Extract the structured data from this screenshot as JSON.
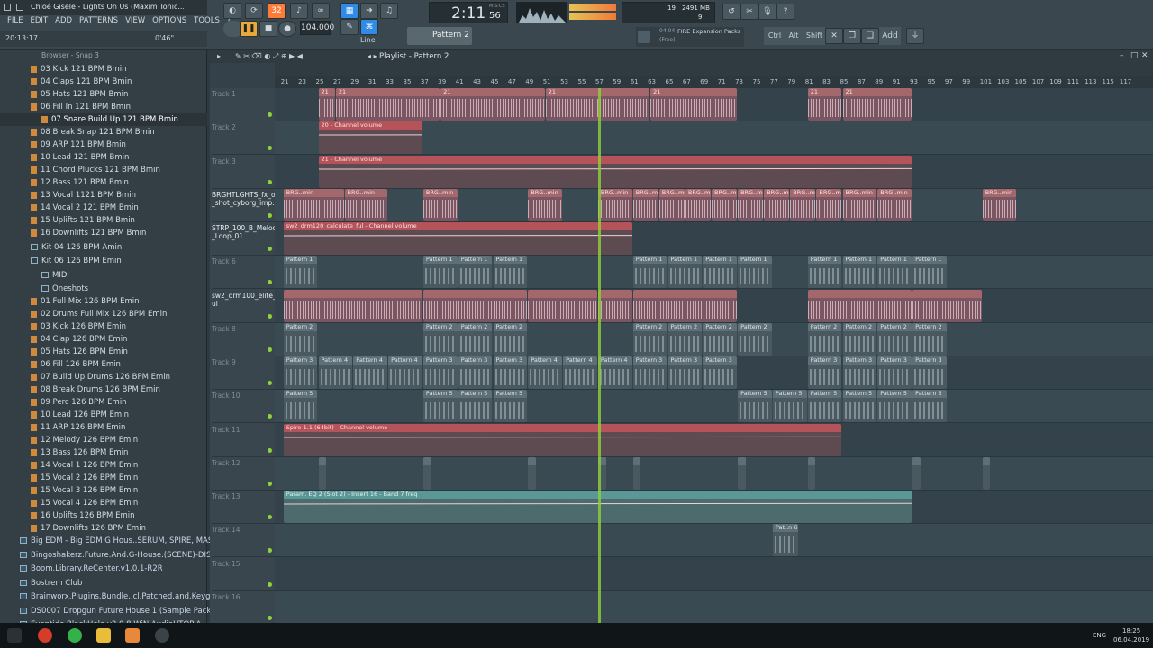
{
  "window": {
    "title": "Chloé Gisele - Lights On Us (Maxim Tonic...",
    "menu": [
      "FILE",
      "EDIT",
      "ADD",
      "PATTERNS",
      "VIEW",
      "OPTIONS",
      "TOOLS",
      "?"
    ],
    "hint_time": "20:13:17",
    "hint_pos": "0'46\""
  },
  "transport": {
    "time": "2:11",
    "time_sub": "56",
    "time_label": "M:S:CS",
    "tempo": "104.000",
    "pattern": "Pattern 2",
    "snap": "Line",
    "cpu": "19",
    "mem": "2491 MB",
    "voices": "9"
  },
  "news": {
    "date": "04.04",
    "text": "FIRE Expansion Packs",
    "sub": "(Free)"
  },
  "keys": [
    "Ctrl",
    "Alt",
    "Shift",
    "Add"
  ],
  "browser": {
    "header": "Browser - Snap 3",
    "items": [
      {
        "label": "03 Kick 121 BPM Bmin",
        "type": "file",
        "indent": 1
      },
      {
        "label": "04 Claps 121 BPM Bmin",
        "type": "file",
        "indent": 1
      },
      {
        "label": "05 Hats 121 BPM Bmin",
        "type": "file",
        "indent": 1
      },
      {
        "label": "06 Fill In 121 BPM Bmin",
        "type": "file",
        "indent": 1
      },
      {
        "label": "07 Snare Build Up 121 BPM Bmin",
        "type": "file",
        "indent": 2,
        "selected": true
      },
      {
        "label": "08 Break Snap 121 BPM Bmin",
        "type": "file",
        "indent": 1
      },
      {
        "label": "09 ARP 121 BPM Bmin",
        "type": "file",
        "indent": 1
      },
      {
        "label": "10 Lead 121 BPM Bmin",
        "type": "file",
        "indent": 1
      },
      {
        "label": "11 Chord Plucks 121 BPM Bmin",
        "type": "file",
        "indent": 1
      },
      {
        "label": "12 Bass 121 BPM Bmin",
        "type": "file",
        "indent": 1
      },
      {
        "label": "13 Vocal 1121 BPM Bmin",
        "type": "file",
        "indent": 1
      },
      {
        "label": "14 Vocal 2 121 BPM Bmin",
        "type": "file",
        "indent": 1
      },
      {
        "label": "15 Uplifts 121 BPM Bmin",
        "type": "file",
        "indent": 1
      },
      {
        "label": "16 Downlifts 121 BPM Bmin",
        "type": "file",
        "indent": 1
      },
      {
        "label": "Kit 04 126 BPM Amin",
        "type": "folder",
        "indent": 1
      },
      {
        "label": "Kit 06 126 BPM Emin",
        "type": "folder",
        "indent": 1,
        "open": true
      },
      {
        "label": "MIDI",
        "type": "folder",
        "indent": 2
      },
      {
        "label": "Oneshots",
        "type": "folder",
        "indent": 2
      },
      {
        "label": "01 Full Mix 126 BPM Emin",
        "type": "file",
        "indent": 1
      },
      {
        "label": "02 Drums Full Mix 126 BPM Emin",
        "type": "file",
        "indent": 1
      },
      {
        "label": "03 Kick 126 BPM Emin",
        "type": "file",
        "indent": 1
      },
      {
        "label": "04 Clap 126 BPM Emin",
        "type": "file",
        "indent": 1
      },
      {
        "label": "05 Hats 126 BPM Emin",
        "type": "file",
        "indent": 1
      },
      {
        "label": "06 Fill 126 BPM Emin",
        "type": "file",
        "indent": 1
      },
      {
        "label": "07 Build Up Drums 126 BPM Emin",
        "type": "file",
        "indent": 1
      },
      {
        "label": "08 Break Drums 126 BPM Emin",
        "type": "file",
        "indent": 1
      },
      {
        "label": "09 Perc 126 BPM Emin",
        "type": "file",
        "indent": 1
      },
      {
        "label": "10 Lead 126 BPM Emin",
        "type": "file",
        "indent": 1
      },
      {
        "label": "11 ARP 126 BPM Emin",
        "type": "file",
        "indent": 1
      },
      {
        "label": "12 Melody 126 BPM Emin",
        "type": "file",
        "indent": 1
      },
      {
        "label": "13 Bass 126 BPM Emin",
        "type": "file",
        "indent": 1
      },
      {
        "label": "14 Vocal 1 126 BPM Emin",
        "type": "file",
        "indent": 1
      },
      {
        "label": "15 Vocal 2 126 BPM Emin",
        "type": "file",
        "indent": 1
      },
      {
        "label": "15 Vocal 3 126 BPM Emin",
        "type": "file",
        "indent": 1
      },
      {
        "label": "15 Vocal 4 126 BPM Emin",
        "type": "file",
        "indent": 1
      },
      {
        "label": "16 Uplifts 126 BPM Emin",
        "type": "file",
        "indent": 1
      },
      {
        "label": "17 Downlifts 126 BPM Emin",
        "type": "file",
        "indent": 1
      }
    ],
    "packs": [
      "Big EDM - Big EDM G Hous..SERUM, SPIRE, MASSIVE)",
      "Bingoshakerz.Future.And.G-House.(SCENE)-DISCOVER",
      "Boom.Library.ReCenter.v1.0.1-R2R",
      "Bostrem Club",
      "Brainworx.Plugins.Bundle..cl.Patched.and.Keygen-R2R",
      "DS0007 Dropgun Future House 1 (Sample Pack)",
      "Eventide.BlackHole.v2.0.8.WiN.AudioUTOPiA"
    ]
  },
  "playlist": {
    "title": "Playlist - Pattern 2",
    "ruler": [
      "21",
      "23",
      "25",
      "27",
      "29",
      "31",
      "33",
      "35",
      "37",
      "39",
      "41",
      "43",
      "45",
      "47",
      "49",
      "51",
      "53",
      "55",
      "57",
      "59",
      "61",
      "63",
      "65",
      "67",
      "69",
      "71",
      "73",
      "75",
      "77",
      "79",
      "81",
      "83",
      "85",
      "87",
      "89",
      "91",
      "93",
      "95",
      "97",
      "99",
      "101",
      "103",
      "105",
      "107",
      "109",
      "111",
      "113",
      "115",
      "117"
    ],
    "tracks": [
      {
        "name": "Track 1",
        "highlight": false
      },
      {
        "name": "Track 2",
        "highlight": false
      },
      {
        "name": "Track 3",
        "highlight": false
      },
      {
        "name": "BRGHTLGHTS_fx_one _shot_cyborg_imp..",
        "highlight": true
      },
      {
        "name": "STRP_100_B_Melody _Loop_01",
        "highlight": true
      },
      {
        "name": "Track 6",
        "highlight": false
      },
      {
        "name": "sw2_drm100_elite_f ul",
        "highlight": true
      },
      {
        "name": "Track 8",
        "highlight": false
      },
      {
        "name": "Track 9",
        "highlight": false
      },
      {
        "name": "Track 10",
        "highlight": false
      },
      {
        "name": "Track 11",
        "highlight": false
      },
      {
        "name": "Track 12",
        "highlight": false
      },
      {
        "name": "Track 13",
        "highlight": false
      },
      {
        "name": "Track 14",
        "highlight": false
      },
      {
        "name": "Track 15",
        "highlight": false
      },
      {
        "name": "Track 16",
        "highlight": false
      }
    ],
    "clips": [
      {
        "track": 0,
        "start": 25,
        "end": 27,
        "label": "21",
        "kind": "audio"
      },
      {
        "track": 0,
        "start": 27,
        "end": 39,
        "label": "21",
        "kind": "audio"
      },
      {
        "track": 0,
        "start": 39,
        "end": 51,
        "label": "21",
        "kind": "audio"
      },
      {
        "track": 0,
        "start": 51,
        "end": 63,
        "label": "21",
        "kind": "audio"
      },
      {
        "track": 0,
        "start": 63,
        "end": 73,
        "label": "21",
        "kind": "audio"
      },
      {
        "track": 0,
        "start": 81,
        "end": 85,
        "label": "21",
        "kind": "audio"
      },
      {
        "track": 0,
        "start": 85,
        "end": 93,
        "label": "21",
        "kind": "audio"
      },
      {
        "track": 1,
        "start": 25,
        "end": 37,
        "label": "20 - Channel volume",
        "kind": "auto"
      },
      {
        "track": 2,
        "start": 25,
        "end": 93,
        "label": "21 - Channel volume",
        "kind": "auto"
      },
      {
        "track": 3,
        "start": 21,
        "end": 28,
        "label": "BRG..min",
        "kind": "audio"
      },
      {
        "track": 3,
        "start": 28,
        "end": 33,
        "label": "BRG..min",
        "kind": "audio"
      },
      {
        "track": 3,
        "start": 37,
        "end": 41,
        "label": "BRG..min",
        "kind": "audio"
      },
      {
        "track": 3,
        "start": 49,
        "end": 53,
        "label": "BRG..min",
        "kind": "audio"
      },
      {
        "track": 3,
        "start": 57,
        "end": 61,
        "label": "BRG..min",
        "kind": "audio"
      },
      {
        "track": 3,
        "start": 61,
        "end": 64,
        "label": "BRG..min",
        "kind": "audio"
      },
      {
        "track": 3,
        "start": 64,
        "end": 67,
        "label": "BRG..min",
        "kind": "audio"
      },
      {
        "track": 3,
        "start": 67,
        "end": 70,
        "label": "BRG..min",
        "kind": "audio"
      },
      {
        "track": 3,
        "start": 70,
        "end": 73,
        "label": "BRG..min",
        "kind": "audio"
      },
      {
        "track": 3,
        "start": 73,
        "end": 76,
        "label": "BRG..min",
        "kind": "audio"
      },
      {
        "track": 3,
        "start": 76,
        "end": 79,
        "label": "BRG..min",
        "kind": "audio"
      },
      {
        "track": 3,
        "start": 79,
        "end": 82,
        "label": "BRG..min",
        "kind": "audio"
      },
      {
        "track": 3,
        "start": 82,
        "end": 85,
        "label": "BRG..min",
        "kind": "audio"
      },
      {
        "track": 3,
        "start": 85,
        "end": 89,
        "label": "BRG..min",
        "kind": "audio"
      },
      {
        "track": 3,
        "start": 89,
        "end": 93,
        "label": "BRG..min",
        "kind": "audio"
      },
      {
        "track": 3,
        "start": 101,
        "end": 105,
        "label": "BRG..min",
        "kind": "audio"
      },
      {
        "track": 4,
        "start": 21,
        "end": 61,
        "label": "sw2_drm120_calculate_ful - Channel volume",
        "kind": "auto"
      },
      {
        "track": 5,
        "start": 21,
        "end": 25,
        "label": "Pattern 1",
        "kind": "pat"
      },
      {
        "track": 5,
        "start": 37,
        "end": 41,
        "label": "Pattern 1",
        "kind": "pat"
      },
      {
        "track": 5,
        "start": 41,
        "end": 45,
        "label": "Pattern 1",
        "kind": "pat"
      },
      {
        "track": 5,
        "start": 45,
        "end": 49,
        "label": "Pattern 1",
        "kind": "pat"
      },
      {
        "track": 5,
        "start": 61,
        "end": 65,
        "label": "Pattern 1",
        "kind": "pat"
      },
      {
        "track": 5,
        "start": 65,
        "end": 69,
        "label": "Pattern 1",
        "kind": "pat"
      },
      {
        "track": 5,
        "start": 69,
        "end": 73,
        "label": "Pattern 1",
        "kind": "pat"
      },
      {
        "track": 5,
        "start": 73,
        "end": 77,
        "label": "Pattern 1",
        "kind": "pat"
      },
      {
        "track": 5,
        "start": 81,
        "end": 85,
        "label": "Pattern 1",
        "kind": "pat"
      },
      {
        "track": 5,
        "start": 85,
        "end": 89,
        "label": "Pattern 1",
        "kind": "pat"
      },
      {
        "track": 5,
        "start": 89,
        "end": 93,
        "label": "Pattern 1",
        "kind": "pat"
      },
      {
        "track": 5,
        "start": 93,
        "end": 97,
        "label": "Pattern 1",
        "kind": "pat"
      },
      {
        "track": 6,
        "start": 21,
        "end": 37,
        "label": "",
        "kind": "audio"
      },
      {
        "track": 6,
        "start": 37,
        "end": 49,
        "label": "",
        "kind": "audio"
      },
      {
        "track": 6,
        "start": 49,
        "end": 57,
        "label": "",
        "kind": "audio"
      },
      {
        "track": 6,
        "start": 57,
        "end": 61,
        "label": "",
        "kind": "audio"
      },
      {
        "track": 6,
        "start": 61,
        "end": 73,
        "label": "",
        "kind": "audio"
      },
      {
        "track": 6,
        "start": 81,
        "end": 93,
        "label": "",
        "kind": "audio"
      },
      {
        "track": 6,
        "start": 93,
        "end": 101,
        "label": "",
        "kind": "audio"
      },
      {
        "track": 7,
        "start": 21,
        "end": 25,
        "label": "Pattern 2",
        "kind": "pat"
      },
      {
        "track": 7,
        "start": 37,
        "end": 41,
        "label": "Pattern 2",
        "kind": "pat"
      },
      {
        "track": 7,
        "start": 41,
        "end": 45,
        "label": "Pattern 2",
        "kind": "pat"
      },
      {
        "track": 7,
        "start": 45,
        "end": 49,
        "label": "Pattern 2",
        "kind": "pat"
      },
      {
        "track": 7,
        "start": 61,
        "end": 65,
        "label": "Pattern 2",
        "kind": "pat"
      },
      {
        "track": 7,
        "start": 65,
        "end": 69,
        "label": "Pattern 2",
        "kind": "pat"
      },
      {
        "track": 7,
        "start": 69,
        "end": 73,
        "label": "Pattern 2",
        "kind": "pat"
      },
      {
        "track": 7,
        "start": 73,
        "end": 77,
        "label": "Pattern 2",
        "kind": "pat"
      },
      {
        "track": 7,
        "start": 81,
        "end": 85,
        "label": "Pattern 2",
        "kind": "pat"
      },
      {
        "track": 7,
        "start": 85,
        "end": 89,
        "label": "Pattern 2",
        "kind": "pat"
      },
      {
        "track": 7,
        "start": 89,
        "end": 93,
        "label": "Pattern 2",
        "kind": "pat"
      },
      {
        "track": 7,
        "start": 93,
        "end": 97,
        "label": "Pattern 2",
        "kind": "pat"
      },
      {
        "track": 8,
        "start": 21,
        "end": 25,
        "label": "Pattern 3",
        "kind": "pat"
      },
      {
        "track": 8,
        "start": 25,
        "end": 29,
        "label": "Pattern 4",
        "kind": "pat"
      },
      {
        "track": 8,
        "start": 29,
        "end": 33,
        "label": "Pattern 4",
        "kind": "pat"
      },
      {
        "track": 8,
        "start": 33,
        "end": 37,
        "label": "Pattern 4",
        "kind": "pat"
      },
      {
        "track": 8,
        "start": 37,
        "end": 41,
        "label": "Pattern 3",
        "kind": "pat"
      },
      {
        "track": 8,
        "start": 41,
        "end": 45,
        "label": "Pattern 3",
        "kind": "pat"
      },
      {
        "track": 8,
        "start": 45,
        "end": 49,
        "label": "Pattern 3",
        "kind": "pat"
      },
      {
        "track": 8,
        "start": 49,
        "end": 53,
        "label": "Pattern 4",
        "kind": "pat"
      },
      {
        "track": 8,
        "start": 53,
        "end": 57,
        "label": "Pattern 4",
        "kind": "pat"
      },
      {
        "track": 8,
        "start": 57,
        "end": 61,
        "label": "Pattern 4",
        "kind": "pat"
      },
      {
        "track": 8,
        "start": 61,
        "end": 65,
        "label": "Pattern 3",
        "kind": "pat"
      },
      {
        "track": 8,
        "start": 65,
        "end": 69,
        "label": "Pattern 3",
        "kind": "pat"
      },
      {
        "track": 8,
        "start": 69,
        "end": 73,
        "label": "Pattern 3",
        "kind": "pat"
      },
      {
        "track": 8,
        "start": 81,
        "end": 85,
        "label": "Pattern 3",
        "kind": "pat"
      },
      {
        "track": 8,
        "start": 85,
        "end": 89,
        "label": "Pattern 3",
        "kind": "pat"
      },
      {
        "track": 8,
        "start": 89,
        "end": 93,
        "label": "Pattern 3",
        "kind": "pat"
      },
      {
        "track": 8,
        "start": 93,
        "end": 97,
        "label": "Pattern 3",
        "kind": "pat"
      },
      {
        "track": 9,
        "start": 21,
        "end": 25,
        "label": "Pattern 5",
        "kind": "pat"
      },
      {
        "track": 9,
        "start": 37,
        "end": 41,
        "label": "Pattern 5",
        "kind": "pat"
      },
      {
        "track": 9,
        "start": 41,
        "end": 45,
        "label": "Pattern 5",
        "kind": "pat"
      },
      {
        "track": 9,
        "start": 45,
        "end": 49,
        "label": "Pattern 5",
        "kind": "pat"
      },
      {
        "track": 9,
        "start": 73,
        "end": 77,
        "label": "Pattern 5",
        "kind": "pat"
      },
      {
        "track": 9,
        "start": 77,
        "end": 81,
        "label": "Pattern 5",
        "kind": "pat"
      },
      {
        "track": 9,
        "start": 81,
        "end": 85,
        "label": "Pattern 5",
        "kind": "pat"
      },
      {
        "track": 9,
        "start": 85,
        "end": 89,
        "label": "Pattern 5",
        "kind": "pat"
      },
      {
        "track": 9,
        "start": 89,
        "end": 93,
        "label": "Pattern 5",
        "kind": "pat"
      },
      {
        "track": 9,
        "start": 93,
        "end": 97,
        "label": "Pattern 5",
        "kind": "pat"
      },
      {
        "track": 10,
        "start": 21,
        "end": 85,
        "label": "Spire-1.1 (64bit) - Channel volume",
        "kind": "auto"
      },
      {
        "track": 11,
        "start": 25,
        "end": 26,
        "label": "",
        "kind": "hit"
      },
      {
        "track": 11,
        "start": 37,
        "end": 38,
        "label": "",
        "kind": "hit"
      },
      {
        "track": 11,
        "start": 49,
        "end": 50,
        "label": "",
        "kind": "hit"
      },
      {
        "track": 11,
        "start": 57,
        "end": 58,
        "label": "",
        "kind": "hit"
      },
      {
        "track": 11,
        "start": 61,
        "end": 62,
        "label": "",
        "kind": "hit"
      },
      {
        "track": 11,
        "start": 73,
        "end": 74,
        "label": "",
        "kind": "hit"
      },
      {
        "track": 11,
        "start": 81,
        "end": 82,
        "label": "",
        "kind": "hit"
      },
      {
        "track": 11,
        "start": 93,
        "end": 94,
        "label": "",
        "kind": "hit"
      },
      {
        "track": 11,
        "start": 101,
        "end": 102,
        "label": "",
        "kind": "hit"
      },
      {
        "track": 12,
        "start": 21,
        "end": 93,
        "label": "Param. EQ 2 (Slot 2) - Insert 16 - Band 7 freq",
        "kind": "teal"
      },
      {
        "track": 13,
        "start": 77,
        "end": 80,
        "label": "Pat..n 6",
        "kind": "pat"
      }
    ],
    "playhead_bar": 57
  },
  "taskbar": {
    "lang": "ENG",
    "clock": "18:25",
    "date": "06.04.2019"
  }
}
